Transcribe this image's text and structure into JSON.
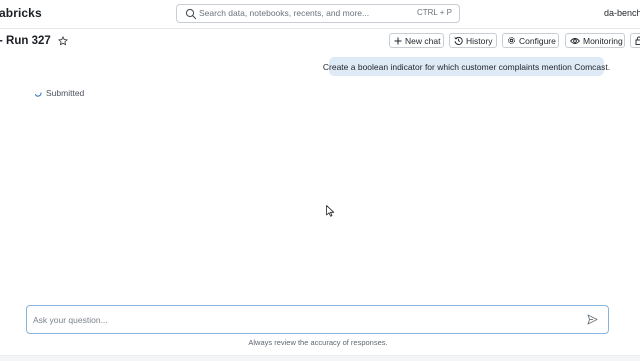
{
  "header": {
    "brand": "abricks",
    "search_placeholder": "Search data, notebooks, recents, and more...",
    "search_shortcut": "CTRL + P",
    "user": "da-bench"
  },
  "page": {
    "title": "- Run 327"
  },
  "toolbar": {
    "new_chat": "New chat",
    "history": "History",
    "configure": "Configure",
    "monitoring": "Monitoring"
  },
  "chat": {
    "user_message": "Create a boolean indicator for which customer complaints mention Comcast.",
    "status": "Submitted"
  },
  "composer": {
    "placeholder": "Ask your question...",
    "disclaimer": "Always review the accuracy of responses."
  },
  "colors": {
    "user_bubble": "#dfeaf7",
    "composer_border": "#8ab4de"
  }
}
